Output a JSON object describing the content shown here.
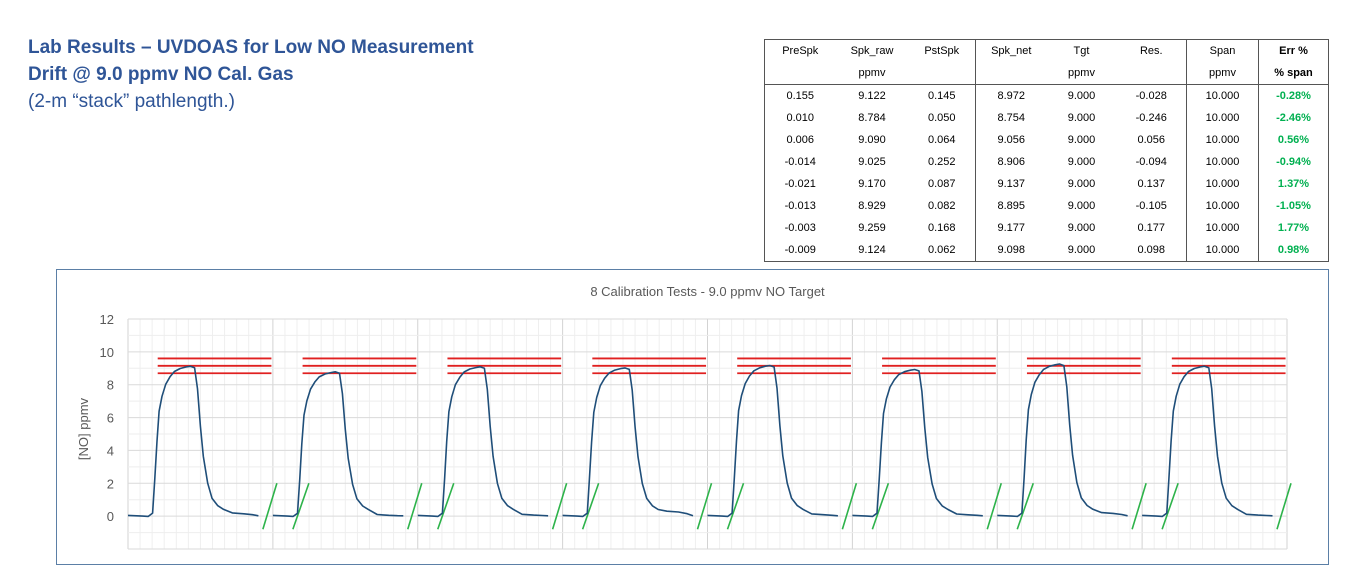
{
  "heading": {
    "line1": "Lab Results – UVDOAS for Low NO Measurement",
    "line2": "Drift @ 9.0 ppmv NO Cal. Gas",
    "line3": "(2-m “stack” pathlength.)"
  },
  "table": {
    "headers": [
      "PreSpk",
      "Spk_raw",
      "PstSpk",
      "Spk_net",
      "Tgt",
      "Res.",
      "Span",
      "Err %"
    ],
    "units": [
      "",
      "ppmv",
      "",
      "",
      "ppmv",
      "",
      "ppmv",
      "% span"
    ],
    "rows": [
      [
        "0.155",
        "9.122",
        "0.145",
        "8.972",
        "9.000",
        "-0.028",
        "10.000",
        "-0.28%"
      ],
      [
        "0.010",
        "8.784",
        "0.050",
        "8.754",
        "9.000",
        "-0.246",
        "10.000",
        "-2.46%"
      ],
      [
        "0.006",
        "9.090",
        "0.064",
        "9.056",
        "9.000",
        "0.056",
        "10.000",
        "0.56%"
      ],
      [
        "-0.014",
        "9.025",
        "0.252",
        "8.906",
        "9.000",
        "-0.094",
        "10.000",
        "-0.94%"
      ],
      [
        "-0.021",
        "9.170",
        "0.087",
        "9.137",
        "9.000",
        "0.137",
        "10.000",
        "1.37%"
      ],
      [
        "-0.013",
        "8.929",
        "0.082",
        "8.895",
        "9.000",
        "-0.105",
        "10.000",
        "-1.05%"
      ],
      [
        "-0.003",
        "9.259",
        "0.168",
        "9.177",
        "9.000",
        "0.177",
        "10.000",
        "1.77%"
      ],
      [
        "-0.009",
        "9.124",
        "0.062",
        "9.098",
        "9.000",
        "0.098",
        "10.000",
        "0.98%"
      ]
    ]
  },
  "chart_data": {
    "type": "line",
    "title": "8 Calibration Tests - 9.0 ppmv NO Target",
    "ylabel": "[NO] ppmv",
    "xlabel": "",
    "ylim": [
      -2,
      12
    ],
    "yticks": [
      "0",
      "2",
      "4",
      "6",
      "8",
      "10",
      "12"
    ],
    "grid": true,
    "legend": "none",
    "tests": 8,
    "tolerance_bands": [
      8.7,
      9.15,
      9.6
    ],
    "peaks": [
      9.122,
      8.784,
      9.09,
      9.025,
      9.17,
      8.929,
      9.259,
      9.124
    ],
    "baselines_post": [
      0.145,
      0.05,
      0.064,
      0.252,
      0.087,
      0.082,
      0.168,
      0.062
    ],
    "colors": {
      "series": "#1f4e79",
      "band": "#e02020",
      "break_mark": "#2db34a",
      "grid": "#e2e2e2",
      "text": "#595959"
    }
  }
}
